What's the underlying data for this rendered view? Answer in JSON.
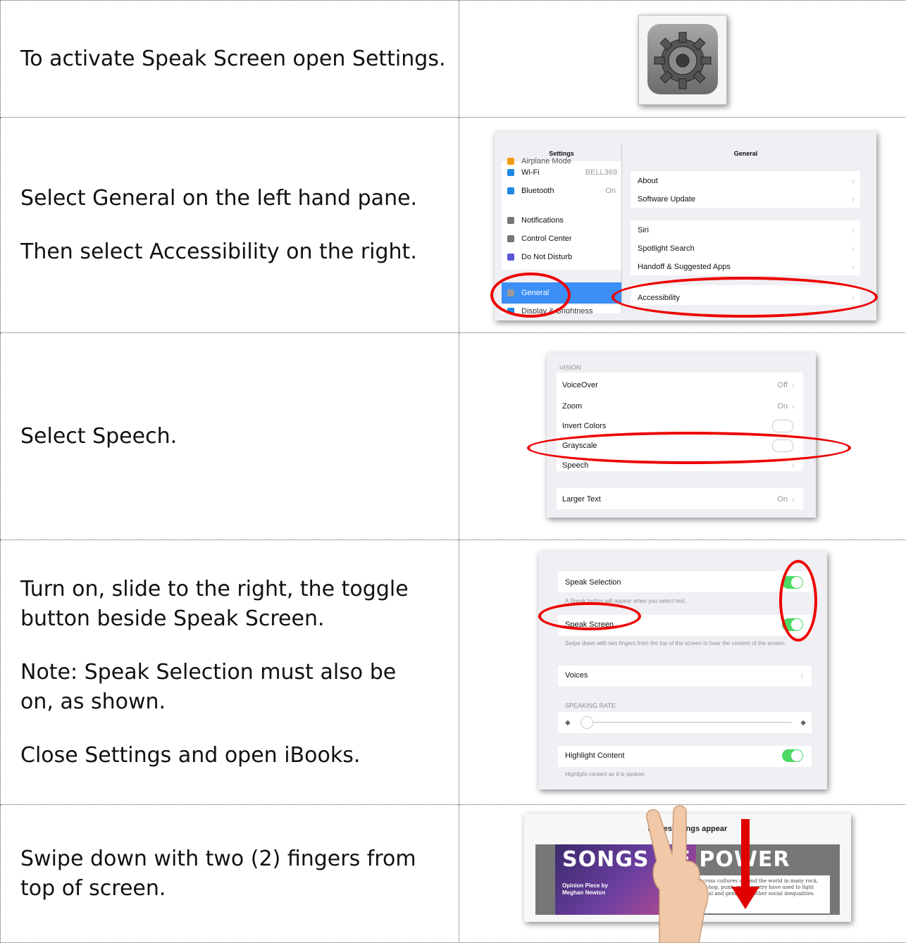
{
  "steps": [
    {
      "lines": [
        "To activate Speak Screen open Settings."
      ]
    },
    {
      "lines": [
        "Select General on the left hand pane.",
        "Then select Accessibility on the right."
      ]
    },
    {
      "lines": [
        "Select Speech."
      ]
    },
    {
      "lines": [
        "Turn on, slide to the right, the toggle button beside Speak Screen.",
        "Note: Speak Selection must also be on, as shown.",
        "Close Settings and open iBooks."
      ]
    },
    {
      "lines": [
        "Swipe down with two (2) fingers from top of screen."
      ]
    }
  ],
  "general_shot": {
    "left_title": "Settings",
    "right_title": "General",
    "left_items": [
      {
        "label": "Airplane Mode",
        "value": ""
      },
      {
        "label": "Wi-Fi",
        "value": "BELL369"
      },
      {
        "label": "Bluetooth",
        "value": "On"
      },
      {
        "label": "Notifications",
        "value": ""
      },
      {
        "label": "Control Center",
        "value": ""
      },
      {
        "label": "Do Not Disturb",
        "value": ""
      },
      {
        "label": "General",
        "value": ""
      },
      {
        "label": "Display & Brightness",
        "value": ""
      }
    ],
    "right_items": [
      "About",
      "Software Update",
      "Siri",
      "Spotlight Search",
      "Handoff & Suggested Apps",
      "Accessibility"
    ]
  },
  "vision_shot": {
    "section": "VISION",
    "items": [
      {
        "label": "VoiceOver",
        "value": "Off"
      },
      {
        "label": "Zoom",
        "value": "On"
      },
      {
        "label": "Invert Colors",
        "value": ""
      },
      {
        "label": "Grayscale",
        "value": ""
      },
      {
        "label": "Speech",
        "value": ""
      },
      {
        "label": "Larger Text",
        "value": "On"
      }
    ]
  },
  "speech_shot": {
    "speak_selection": "Speak Selection",
    "speak_selection_note": "A Speak button will appear when you select text.",
    "speak_screen": "Speak Screen",
    "speak_screen_note": "Swipe down with two fingers from the top of the screen to hear the content of the screen.",
    "voices": "Voices",
    "rate_header": "SPEAKING RATE",
    "highlight": "Highlight Content",
    "highlight_note": "Highlight content as it is spoken."
  },
  "ibooks_shot": {
    "top_title": "Protest songs appear",
    "headline": "SONGS OF POWER",
    "byline1": "Opinion Piece by",
    "byline2": "Meghan Newton",
    "body_text": "Across cultures around the world in many rock, hip-hop, punk, rap, country have used to fight racial and gender for other social inequalities."
  },
  "colors": {
    "annotation_red": "#e00000",
    "ios_blue": "#1e88e5",
    "toggle_green": "#4cd964"
  }
}
